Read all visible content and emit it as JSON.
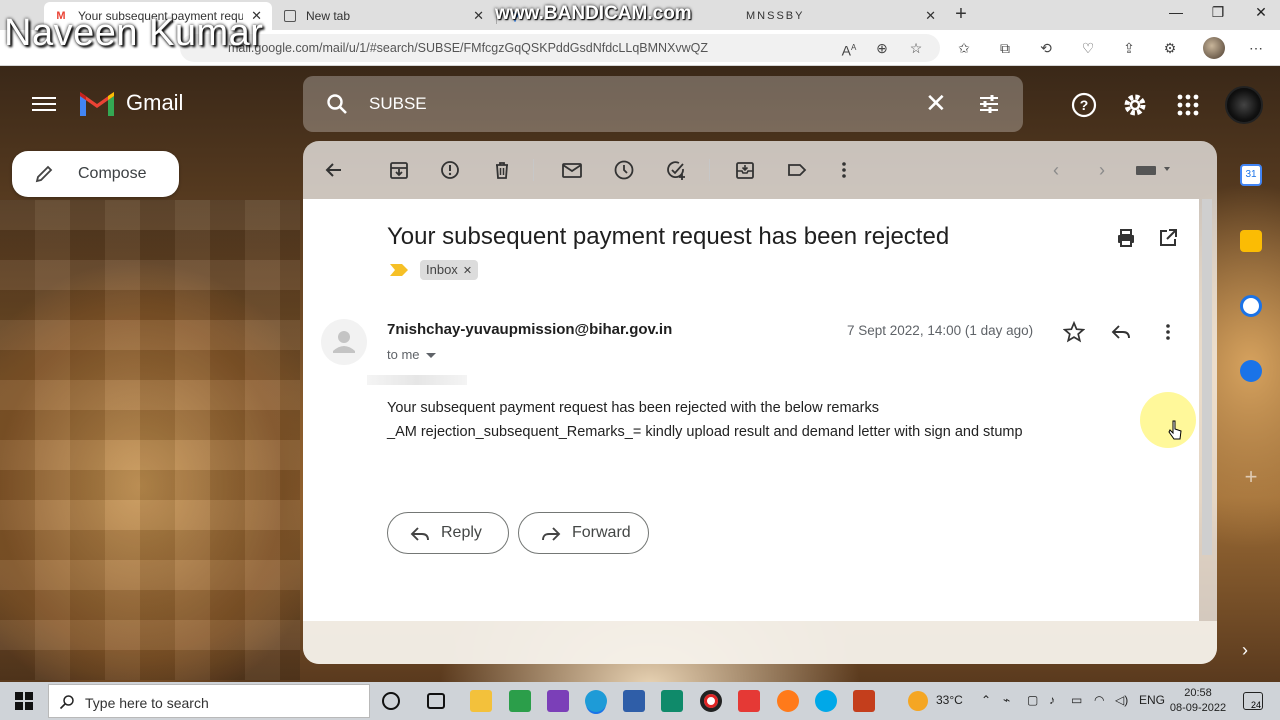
{
  "browser": {
    "tabs": [
      {
        "label": "Your subsequent payment reque"
      },
      {
        "label": "New tab"
      },
      {
        "label": "MNSSBY"
      }
    ],
    "url": "mail.google.com/mail/u/1/#search/SUBSE/FMfcgzGqQSKPddGsdNfdcLLqBMNXvwQZ"
  },
  "overlay": {
    "name": "Naveen Kumar",
    "watermark": "www.BANDICAM.com"
  },
  "gmail": {
    "app_name": "Gmail",
    "search_query": "SUBSE",
    "compose_label": "Compose"
  },
  "email": {
    "subject": "Your subsequent payment request has been rejected",
    "label": "Inbox",
    "sender": "7nishchay-yuvaupmission@bihar.gov.in",
    "recipient": "to me",
    "date": "7 Sept 2022, 14:00 (1 day ago)",
    "body_lines": [
      "Your subsequent payment request has been rejected with the below remarks",
      "_AM rejection_subsequent_Remarks_= kindly upload result and demand letter with sign and stump"
    ],
    "reply_label": "Reply",
    "forward_label": "Forward"
  },
  "taskbar": {
    "search_placeholder": "Type here to search",
    "temperature": "33°C",
    "language": "ENG",
    "time": "20:58",
    "date": "08-09-2022",
    "notifications": "24"
  },
  "colors": {
    "gmail_red": "#ea4335",
    "gmail_blue": "#4285f4",
    "gmail_green": "#34a853",
    "gmail_yellow": "#fbbc04",
    "label_yellow": "#f6c026"
  }
}
